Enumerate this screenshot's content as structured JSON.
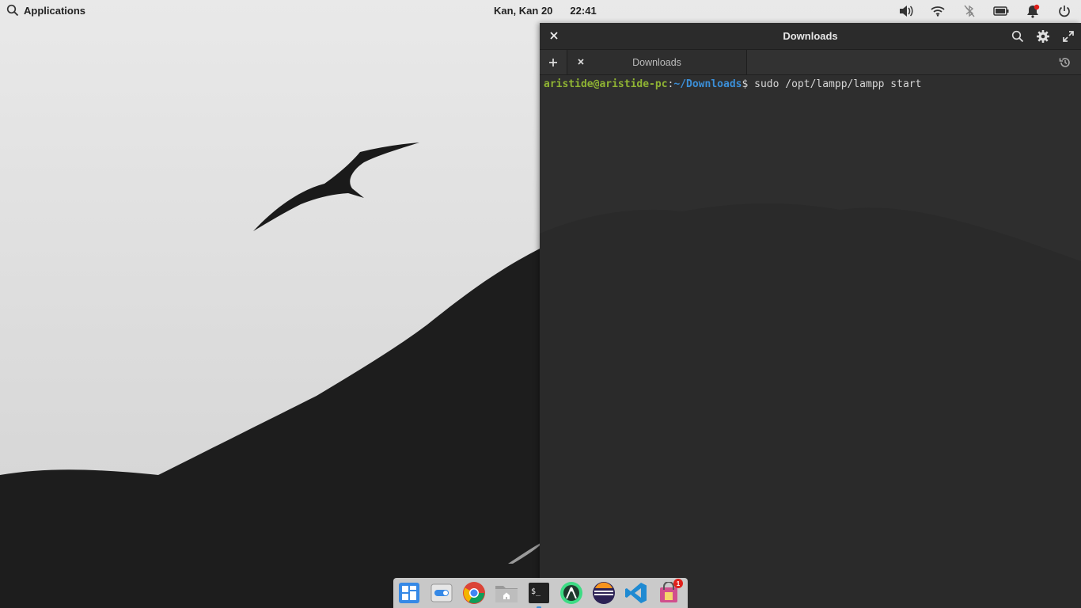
{
  "panel": {
    "applications_label": "Applications",
    "date": "Kan, Kan 20",
    "time": "22:41",
    "tray_icons": [
      "volume-icon",
      "wifi-icon",
      "bluetooth-off-icon",
      "battery-icon",
      "notifications-icon",
      "power-icon"
    ]
  },
  "terminal": {
    "window_title": "Downloads",
    "tab_label": "Downloads",
    "prompt_user": "aristide@aristide-pc",
    "prompt_colon": ":",
    "prompt_path": "~/Downloads",
    "prompt_symbol": "$ ",
    "command": "sudo /opt/lampp/lampp start"
  },
  "dock": {
    "items": [
      "multitasking-view",
      "system-settings",
      "chrome",
      "files",
      "terminal",
      "android-studio",
      "eclipse",
      "vscode",
      "appcenter"
    ],
    "appcenter_badge": "1"
  },
  "colors": {
    "prompt_user": "#8fb333",
    "prompt_path": "#3b8fd8",
    "terminal_bg": "#2e2e2e",
    "badge": "#e0201b"
  }
}
